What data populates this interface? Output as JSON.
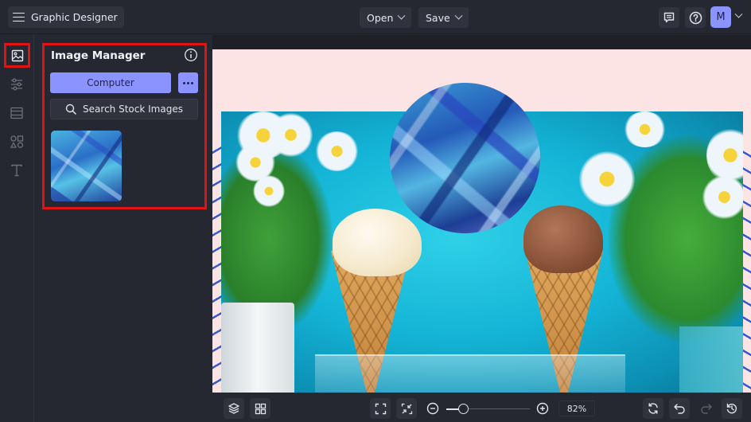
{
  "topbar": {
    "app_title": "Graphic Designer",
    "menu_icon": "hamburger-menu-icon",
    "open_label": "Open",
    "save_label": "Save",
    "feedback_icon": "comment-icon",
    "help_icon": "help-circle-icon",
    "avatar_initial": "M"
  },
  "rail": {
    "items": [
      {
        "id": "images",
        "icon": "image-icon",
        "active": true
      },
      {
        "id": "adjustments",
        "icon": "sliders-icon",
        "active": false
      },
      {
        "id": "layout",
        "icon": "layout-icon",
        "active": false
      },
      {
        "id": "shapes",
        "icon": "shapes-icon",
        "active": false
      },
      {
        "id": "text",
        "icon": "text-icon",
        "active": false
      }
    ]
  },
  "panel": {
    "title": "Image Manager",
    "computer_label": "Computer",
    "more_icon": "ellipsis-icon",
    "search_label": "Search Stock Images",
    "thumbnails": [
      {
        "description": "Blue abstract paint texture"
      }
    ]
  },
  "canvas": {
    "background_color": "#fde4e4",
    "stripe_color": "#3558d4",
    "photo_description": "Two ice cream cones (vanilla and chocolate) on glass stand, blue background with white flowers",
    "circle_image_description": "Blue abstract paint texture cropped to circle"
  },
  "bottombar": {
    "zoom_value": "82%",
    "zoom_percent": 82,
    "buttons": [
      "layers-icon",
      "grid-icon",
      "fit-screen-icon",
      "shrink-icon",
      "zoom-out-icon",
      "zoom-in-icon",
      "replace-icon",
      "undo-icon",
      "redo-icon",
      "history-icon"
    ]
  },
  "colors": {
    "accent": "#8b93ff",
    "highlight": "#e01414",
    "background": "#252731"
  }
}
